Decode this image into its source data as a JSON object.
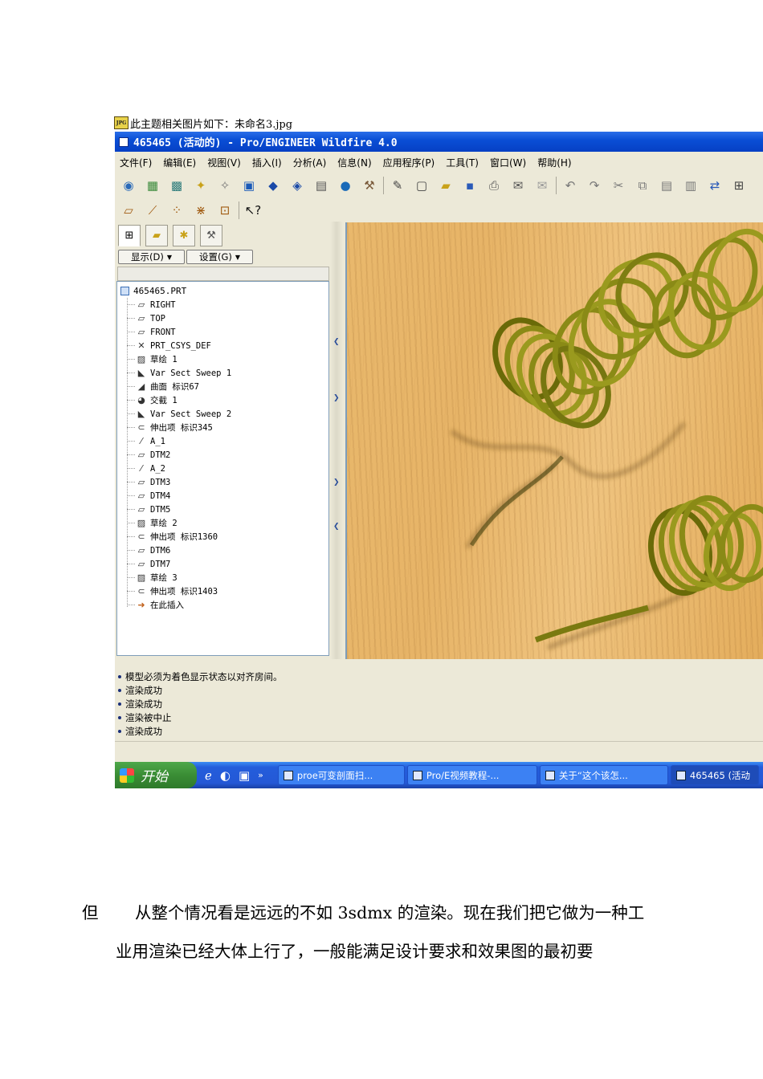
{
  "caption": {
    "icon": "jpg-file-icon",
    "icon_text": "JPG",
    "text": "此主题相关图片如下：未命名3.jpg"
  },
  "window": {
    "title": "465465 (活动的) - Pro/ENGINEER Wildfire 4.0"
  },
  "menu": {
    "items": [
      "文件(F)",
      "编辑(E)",
      "视图(V)",
      "插入(I)",
      "分析(A)",
      "信息(N)",
      "应用程序(P)",
      "工具(T)",
      "窗口(W)",
      "帮助(H)"
    ]
  },
  "model_tree": {
    "display_label": "显示(D)",
    "settings_label": "设置(G)",
    "root": "465465.PRT",
    "items": [
      {
        "icon": "datum-plane-icon",
        "label": "RIGHT"
      },
      {
        "icon": "datum-plane-icon",
        "label": "TOP"
      },
      {
        "icon": "datum-plane-icon",
        "label": "FRONT"
      },
      {
        "icon": "coordinate-system-icon",
        "label": "PRT_CSYS_DEF"
      },
      {
        "icon": "sketch-icon",
        "label": "草绘 1"
      },
      {
        "icon": "sweep-icon",
        "label": "Var Sect Sweep 1"
      },
      {
        "icon": "surface-icon",
        "label": "曲面 标识67"
      },
      {
        "icon": "intersect-icon",
        "label": "交截 1"
      },
      {
        "icon": "sweep-icon",
        "label": "Var Sect Sweep 2"
      },
      {
        "icon": "extrude-icon",
        "label": "伸出项 标识345"
      },
      {
        "icon": "datum-axis-icon",
        "label": "A_1"
      },
      {
        "icon": "datum-plane-icon",
        "label": "DTM2"
      },
      {
        "icon": "datum-axis-icon",
        "label": "A_2"
      },
      {
        "icon": "datum-plane-icon",
        "label": "DTM3"
      },
      {
        "icon": "datum-plane-icon",
        "label": "DTM4"
      },
      {
        "icon": "datum-plane-icon",
        "label": "DTM5"
      },
      {
        "icon": "sketch-icon",
        "label": "草绘 2"
      },
      {
        "icon": "extrude-icon",
        "label": "伸出项 标识1360"
      },
      {
        "icon": "datum-plane-icon",
        "label": "DTM6"
      },
      {
        "icon": "datum-plane-icon",
        "label": "DTM7"
      },
      {
        "icon": "sketch-icon",
        "label": "草绘 3"
      },
      {
        "icon": "extrude-icon",
        "label": "伸出项 标识1403"
      },
      {
        "icon": "insert-here-arrow-icon",
        "label": "在此插入"
      }
    ]
  },
  "messages": [
    "模型必须为着色显示状态以对齐房间。",
    "渲染成功",
    "渲染成功",
    "渲染被中止",
    "渲染成功"
  ],
  "taskbar": {
    "start_label": "开始",
    "tasks": [
      {
        "label": "proe可变剖面扫..."
      },
      {
        "label": "Pro/E视频教程-..."
      },
      {
        "label": "关于“这个该怎..."
      },
      {
        "label": "465465 (活动"
      }
    ]
  },
  "body_text": {
    "line1_lead": "但",
    "line1_rest": "从整个情况看是远远的不如 3sdmx 的渲染。现在我们把它做为一种工",
    "line2": "业用渲染已经大体上行了，一般能满足设计要求和效果图的最初要"
  },
  "colors": {
    "titlebar": "#0a4fd6",
    "coil": "#8a8a1a",
    "wood": "#e9b86c",
    "taskbar": "#245ddb",
    "start": "#3a8d35"
  }
}
